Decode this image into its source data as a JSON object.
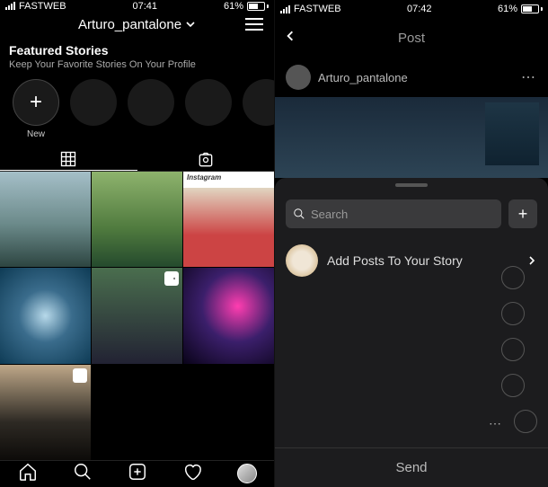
{
  "left": {
    "status": {
      "carrier": "FASTWEB",
      "time": "07:41",
      "battery": "61%"
    },
    "header": {
      "username": "Arturo_pantalone"
    },
    "featured": {
      "title": "Featured Stories",
      "subtitle": "Keep Your Favorite Stories On Your Profile",
      "new_label": "New"
    },
    "tabs": {
      "grid": "grid-icon",
      "tagged": "tagged-icon"
    },
    "grid": {
      "items": [
        "mountain-bird",
        "waterfall-island",
        "instagram-bridge",
        "goddess-art",
        "rabbit-render",
        "nebula-flare",
        "modern-hotel",
        "empty",
        "empty"
      ],
      "badge_video": "video",
      "badge_multi": "multi",
      "img3_header": "Instagram"
    },
    "nav": [
      "home",
      "search",
      "create",
      "activity",
      "profile"
    ]
  },
  "right": {
    "status": {
      "carrier": "FASTWEB",
      "time": "07:42",
      "battery": "61%"
    },
    "header": {
      "title": "Post"
    },
    "post": {
      "username": "Arturo_pantalone"
    },
    "sheet": {
      "search_placeholder": "Search",
      "add_story": "Add Posts To Your Story",
      "send": "Send"
    }
  }
}
